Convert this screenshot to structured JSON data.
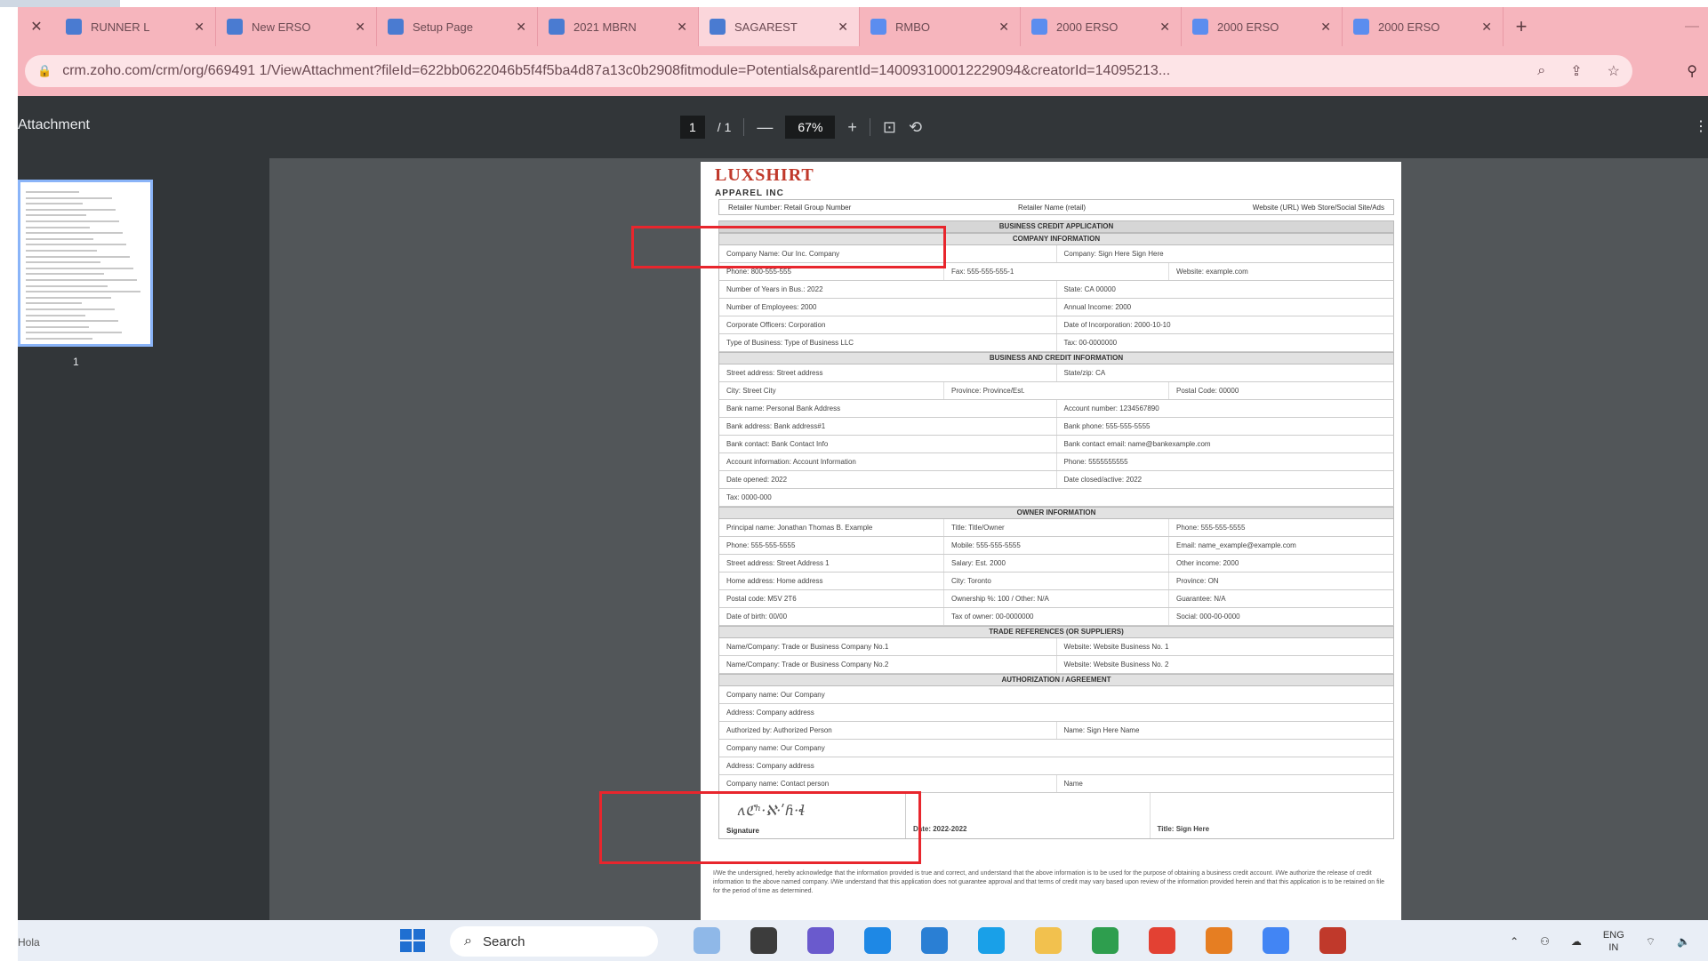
{
  "browser": {
    "tabs": [
      {
        "label": "RUNNER L",
        "fav_color": "#4a7bd1",
        "active": false
      },
      {
        "label": "New ERSO",
        "fav_color": "#4a7bd1",
        "active": false
      },
      {
        "label": "Setup Page",
        "fav_color": "#4a7bd1",
        "active": false
      },
      {
        "label": "2021 MBRN",
        "fav_color": "#4a7bd1",
        "active": false
      },
      {
        "label": "SAGAREST",
        "fav_color": "#4a7bd1",
        "active": true
      },
      {
        "label": "RMBO",
        "fav_color": "#5b8def",
        "active": false
      },
      {
        "label": "2000 ERSO",
        "fav_color": "#5b8def",
        "active": false
      },
      {
        "label": "2000 ERSO",
        "fav_color": "#5b8def",
        "active": false
      },
      {
        "label": "2000 ERSO",
        "fav_color": "#5b8def",
        "active": false
      }
    ],
    "close_glyph": "✕",
    "new_tab_glyph": "+",
    "url": "crm.zoho.com/crm/org/669491 1/ViewAttachment?fileId=622bb0622046b5f4f5ba4d87a13c0b2908fitmodule=Potentials&parentId=140093100012229094&creatorId=14095213..."
  },
  "pdf": {
    "title": "Attachment",
    "page_current": "1",
    "page_total": "/ 1",
    "zoom": "67%",
    "thumb_number": "1"
  },
  "document": {
    "logo_main": "LUXSHIRT",
    "logo_sub": "APPAREL INC",
    "header_left": "Retailer Number: Retail Group Number",
    "header_mid": "Retailer Name (retail)",
    "header_right": "Website (URL) Web Store/Social Site/Ads",
    "title": "BUSINESS CREDIT APPLICATION",
    "sections": [
      {
        "heading": "COMPANY INFORMATION",
        "rows": [
          [
            "Company Name: Our Inc. Company",
            "Company: Sign Here Sign Here"
          ],
          [
            "Phone: 800-555-555",
            "Fax: 555-555-555-1",
            "Website: example.com"
          ],
          [
            "Number of Years in Bus.: 2022",
            "State: CA 00000"
          ],
          [
            "Number of Employees: 2000",
            "Annual Income: 2000"
          ],
          [
            "Corporate Officers: Corporation",
            "Date of Incorporation: 2000-10-10"
          ],
          [
            "Type of Business: Type of Business LLC",
            "Tax: 00-0000000"
          ]
        ]
      },
      {
        "heading": "BUSINESS AND CREDIT INFORMATION",
        "rows": [
          [
            "Street address: Street address",
            "State/zip: CA"
          ],
          [
            "City: Street City",
            "Province: Province/Est.",
            "Postal Code: 00000"
          ],
          [
            "Bank name: Personal Bank Address",
            "Account number: 1234567890"
          ],
          [
            "Bank address: Bank address#1",
            "Bank phone: 555-555-5555"
          ],
          [
            "Bank contact: Bank Contact Info",
            "Bank contact email: name@bankexample.com"
          ],
          [
            "Account information: Account Information",
            "Phone: 5555555555"
          ],
          [
            "Date opened: 2022",
            "Date closed/active: 2022"
          ],
          [
            "Tax: 0000-000"
          ]
        ]
      },
      {
        "heading": "OWNER INFORMATION",
        "rows": [
          [
            "Principal name: Jonathan Thomas B. Example",
            "Title: Title/Owner",
            "Phone: 555-555-5555"
          ],
          [
            "Phone: 555-555-5555",
            "Mobile: 555-555-5555",
            "Email: name_example@example.com"
          ],
          [
            "Street address: Street Address 1",
            "Salary: Est. 2000",
            "Other income: 2000"
          ],
          [
            "Home address: Home address",
            "City: Toronto",
            "Province: ON"
          ],
          [
            "Postal code: M5V 2T6",
            "Ownership %: 100 / Other: N/A",
            "Guarantee: N/A"
          ],
          [
            "Date of birth: 00/00",
            "Tax of owner: 00-0000000",
            "Social: 000-00-0000"
          ]
        ]
      },
      {
        "heading": "TRADE REFERENCES (OR SUPPLIERS)",
        "rows": [
          [
            "Name/Company: Trade or Business Company No.1",
            "Website: Website Business No. 1"
          ],
          [
            "Name/Company: Trade or Business Company No.2",
            "Website: Website Business No. 2"
          ]
        ]
      },
      {
        "heading": "AUTHORIZATION / AGREEMENT",
        "rows": [
          [
            "Company name: Our Company"
          ],
          [
            "Address: Company address"
          ],
          [
            "Authorized by: Authorized Person",
            "Name: Sign Here Name"
          ],
          [
            "Company name: Our Company"
          ],
          [
            "Address: Company address"
          ],
          [
            "Company name: Contact person",
            "Name"
          ]
        ]
      }
    ],
    "signature_scribble": "ʌℭʰ·ℵ·ʹɦ·ɬ",
    "signature_label": "Signature",
    "sig_mid": "Date: 2022-2022",
    "sig_right": "Title: Sign Here",
    "footer": "I/We the undersigned, hereby acknowledge that the information provided is true and correct, and understand that the above information is to be used for the purpose of obtaining a business credit account. I/We authorize the release of credit information to the above named company. I/We understand that this application does not guarantee approval and that terms of credit may vary based upon review of the information provided herein and that this application is to be retained on file for the period of time as determined."
  },
  "taskbar": {
    "left_text": "Hola",
    "search_placeholder": "Search",
    "tray_lang": "ENG",
    "tray_region": "IN"
  },
  "colors": {
    "tab_strip": "#f6b5bd",
    "annotation_red": "#e8262d",
    "pdf_toolbar": "#323639",
    "viewer_bg": "#525659"
  }
}
